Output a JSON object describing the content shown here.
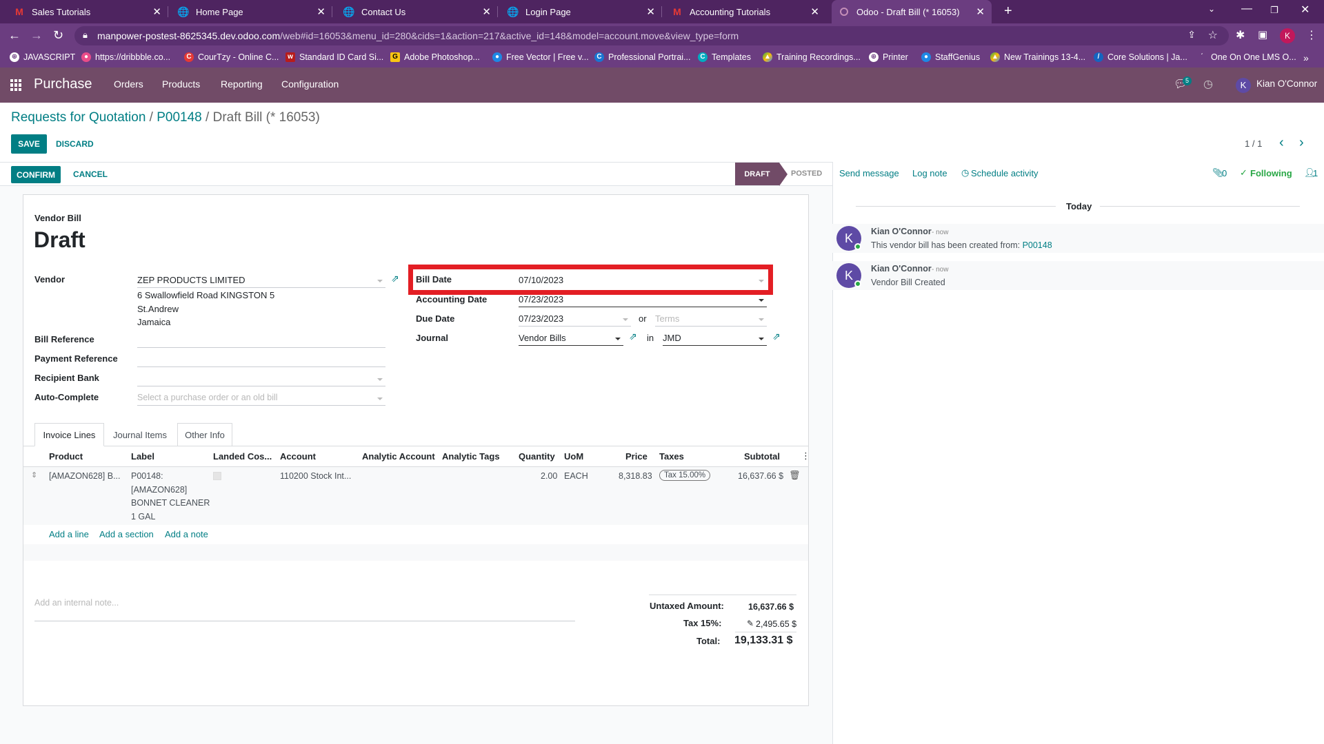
{
  "browser": {
    "tabs": [
      {
        "title": "Sales Tutorials",
        "icon": "gmail-icon"
      },
      {
        "title": "Home Page",
        "icon": "globe-icon"
      },
      {
        "title": "Contact Us",
        "icon": "globe-icon"
      },
      {
        "title": "Login Page",
        "icon": "globe-icon"
      },
      {
        "title": "Accounting Tutorials",
        "icon": "gmail-icon"
      },
      {
        "title": "Odoo - Draft Bill (* 16053)",
        "icon": "odoo-icon"
      }
    ],
    "url_host": "manpower-postest-8625345.dev.odoo.com",
    "url_path": "/web#id=16053&menu_id=280&cids=1&action=217&active_id=148&model=account.move&view_type=form",
    "profile_initial": "K",
    "bookmarks": [
      "JAVASCRIPT",
      "https://dribbble.co...",
      "CourTzy - Online C...",
      "Standard ID Card Si...",
      "Adobe Photoshop...",
      "Free Vector | Free v...",
      "Professional Portrai...",
      "Templates",
      "Training Recordings...",
      "Printer",
      "StaffGenius",
      "New Trainings 13-4...",
      "Core Solutions | Ja...",
      "One On One LMS O..."
    ]
  },
  "navbar": {
    "app": "Purchase",
    "menus": [
      "Orders",
      "Products",
      "Reporting",
      "Configuration"
    ],
    "messages_count": "5",
    "user_initial": "K",
    "user_name": "Kian O'Connor"
  },
  "control": {
    "breadcrumb_1": "Requests for Quotation",
    "breadcrumb_sep": " / ",
    "breadcrumb_2": "P00148",
    "breadcrumb_3": "Draft Bill (* 16053)",
    "save": "SAVE",
    "discard": "DISCARD",
    "pager": "1 / 1"
  },
  "status": {
    "confirm": "CONFIRM",
    "cancel": "CANCEL",
    "draft": "DRAFT",
    "posted": "POSTED"
  },
  "form": {
    "type_label": "Vendor Bill",
    "name": "Draft",
    "vendor_label": "Vendor",
    "vendor_value": "ZEP PRODUCTS LIMITED",
    "vendor_address_1": "6 Swallowfield Road KINGSTON 5",
    "vendor_address_2": "St.Andrew",
    "vendor_address_3": "Jamaica",
    "bill_ref_label": "Bill Reference",
    "payment_ref_label": "Payment Reference",
    "recipient_bank_label": "Recipient Bank",
    "autocomplete_label": "Auto-Complete",
    "autocomplete_placeholder": "Select a purchase order or an old bill",
    "bill_date_label": "Bill Date",
    "bill_date_value": "07/10/2023",
    "accounting_date_label": "Accounting Date",
    "accounting_date_value": "07/23/2023",
    "due_date_label": "Due Date",
    "due_date_value": "07/23/2023",
    "or": "or",
    "terms_placeholder": "Terms",
    "journal_label": "Journal",
    "journal_value": "Vendor Bills",
    "in": "in",
    "currency_value": "JMD",
    "tabs": [
      "Invoice Lines",
      "Journal Items",
      "Other Info"
    ],
    "columns": [
      "Product",
      "Label",
      "Landed Cos...",
      "Account",
      "Analytic Account",
      "Analytic Tags",
      "Quantity",
      "UoM",
      "Price",
      "Taxes",
      "Subtotal"
    ],
    "line": {
      "product": "[AMAZON628] B...",
      "label_1": "P00148:",
      "label_2": "[AMAZON628]",
      "label_3": "BONNET CLEANER",
      "label_4": "1 GAL",
      "account": "110200 Stock Int...",
      "quantity": "2.00",
      "uom": "EACH",
      "price": "8,318.83",
      "tax": "Tax 15.00%",
      "subtotal": "16,637.66 $"
    },
    "add_line": "Add a line",
    "add_section": "Add a section",
    "add_note": "Add a note",
    "internal_note_placeholder": "Add an internal note...",
    "untaxed_label": "Untaxed Amount:",
    "untaxed_value": "16,637.66 $",
    "tax_label": "Tax 15%:",
    "tax_value": "2,495.65 $",
    "total_label": "Total:",
    "total_value": "19,133.31 $"
  },
  "chatter": {
    "send_message": "Send message",
    "log_note": "Log note",
    "schedule_activity": "Schedule activity",
    "attachments": "0",
    "following": "Following",
    "followers": "1",
    "day": "Today",
    "messages": [
      {
        "author": "Kian O'Connor",
        "time": "- now",
        "body": "This vendor bill has been created from: ",
        "link": "P00148"
      },
      {
        "author": "Kian O'Connor",
        "time": "- now",
        "body": "Vendor Bill Created",
        "link": ""
      }
    ]
  },
  "colors": {
    "browser_tab_bg": "#4e2460",
    "browser_toolbar": "#6b3d80",
    "odoo_navbar": "#714b67",
    "primary": "#017e84",
    "highlight": "#e31e24"
  }
}
